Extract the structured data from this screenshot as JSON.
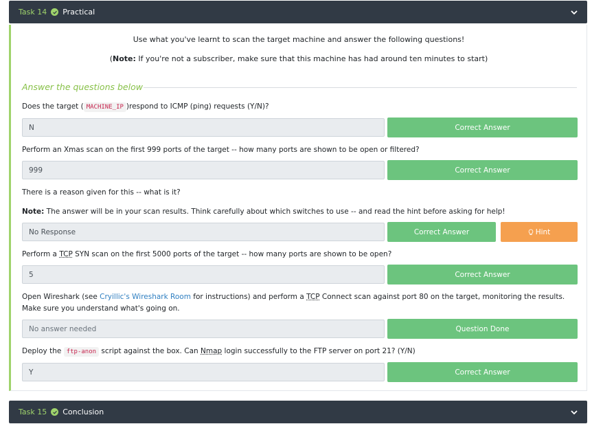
{
  "task14": {
    "number": "Task 14",
    "title": "Practical",
    "intro": "Use what you've learnt to scan the target machine and answer the following questions!",
    "note_label": "Note:",
    "note_text": " If you're not a subscriber, make sure that this machine has had around ten minutes to start)",
    "note_open": "(",
    "answer_heading": "Answer the questions below",
    "questions": [
      {
        "text_before": "Does the target (",
        "code": "MACHINE_IP",
        "text_after": ")respond to ICMP (ping) requests (Y/N)?",
        "answer": "N",
        "button": "Correct Answer"
      },
      {
        "text": "Perform an Xmas scan on the first 999 ports of the target -- how many ports are shown to be open or filtered?",
        "answer": "999",
        "button": "Correct Answer"
      },
      {
        "text": "There is a reason given for this -- what is it?",
        "note_label": "Note:",
        "note_text": " The answer will be in your scan results. Think carefully about which switches to use -- and read the hint before asking for help!",
        "answer": "No Response",
        "button": "Correct Answer",
        "hint": "Hint"
      },
      {
        "text_before": "Perform a ",
        "abbr": "TCP",
        "text_after": " SYN scan on the first 5000 ports of the target -- how many ports are shown to be open?",
        "answer": "5",
        "button": "Correct Answer"
      },
      {
        "text_before": "Open Wireshark (see ",
        "link": "Cryillic's Wireshark Room",
        "text_mid": " for instructions) and perform a ",
        "abbr": "TCP",
        "text_after": " Connect scan against port 80 on the target, monitoring the results. Make sure you understand what's going on.",
        "placeholder": "No answer needed",
        "button": "Question Done"
      },
      {
        "text_before": "Deploy the ",
        "code": "ftp-anon",
        "text_mid": " script against the box. Can ",
        "abbr": "Nmap",
        "text_after": " login successfully to the FTP server on port 21? (Y/N)",
        "answer": "Y",
        "button": "Correct Answer"
      }
    ]
  },
  "task15": {
    "number": "Task 15",
    "title": "Conclusion"
  },
  "colors": {
    "header_bg": "#313a45",
    "accent_green": "#9fd36b",
    "button_green": "#6cc47e",
    "hint_orange": "#f5a04f"
  },
  "icons": [
    "check-circle-icon",
    "chevron-down-icon",
    "lightbulb-icon"
  ]
}
